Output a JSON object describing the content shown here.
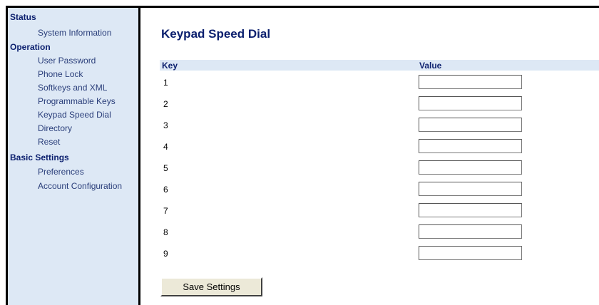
{
  "sidebar": {
    "sections": [
      {
        "title": "Status",
        "items": [
          "System Information"
        ]
      },
      {
        "title": "Operation",
        "items": [
          "User Password",
          "Phone Lock",
          "Softkeys and XML",
          "Programmable Keys",
          "Keypad Speed Dial",
          "Directory",
          "Reset"
        ]
      },
      {
        "title": "Basic Settings",
        "items": [
          "Preferences",
          "Account Configuration"
        ]
      }
    ]
  },
  "main": {
    "title": "Keypad Speed Dial",
    "columns": {
      "key": "Key",
      "value": "Value"
    },
    "rows": [
      {
        "key": "1",
        "value": ""
      },
      {
        "key": "2",
        "value": ""
      },
      {
        "key": "3",
        "value": ""
      },
      {
        "key": "4",
        "value": ""
      },
      {
        "key": "5",
        "value": ""
      },
      {
        "key": "6",
        "value": ""
      },
      {
        "key": "7",
        "value": ""
      },
      {
        "key": "8",
        "value": ""
      },
      {
        "key": "9",
        "value": ""
      }
    ],
    "save_label": "Save Settings"
  },
  "colors": {
    "sidebar_bg": "#dde8f5",
    "heading": "#0b1f6e",
    "link": "#2a3e7a"
  }
}
